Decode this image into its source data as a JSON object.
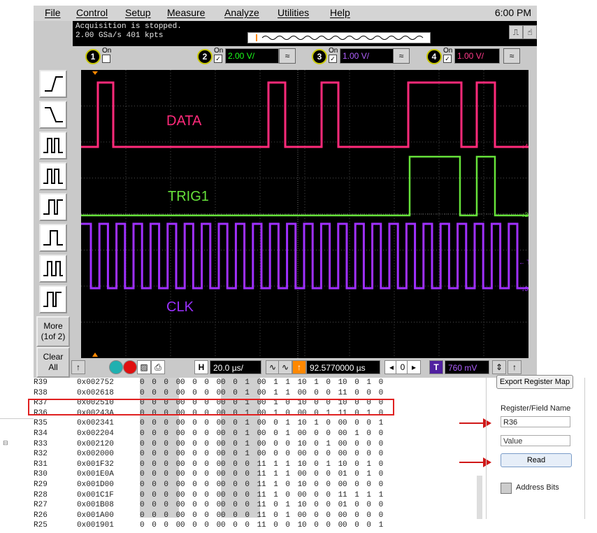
{
  "menubar": {
    "items": [
      "File",
      "Control",
      "Setup",
      "Measure",
      "Analyze",
      "Utilities",
      "Help"
    ],
    "clock": "6:00 PM"
  },
  "status": {
    "line1": "Acquisition is stopped.",
    "line2": "2.00 GSa/s   401 kpts"
  },
  "channels": [
    {
      "num": "1",
      "on_label": "On",
      "checked": false,
      "scale": ""
    },
    {
      "num": "2",
      "on_label": "On",
      "checked": true,
      "scale": "2.00 V/",
      "color": "#1aff1a"
    },
    {
      "num": "3",
      "on_label": "On",
      "checked": true,
      "scale": "1.00 V/",
      "color": "#a040ff"
    },
    {
      "num": "4",
      "on_label": "On",
      "checked": true,
      "scale": "1.00 V/",
      "color": "#ff2080"
    }
  ],
  "sidebar": {
    "more_label": "More\n(1of 2)",
    "clear_label": "Clear\nAll"
  },
  "waveforms": {
    "data_label": "DATA",
    "trig_label": "TRIG1",
    "clk_label": "CLK",
    "data_color": "#ff2a7a",
    "trig_color": "#66e23a",
    "clk_color": "#a030ff"
  },
  "bottombar": {
    "h_label": "H",
    "h_scale": "20.0 µs/",
    "delay": "92.5770000 µs",
    "t_label": "T",
    "trig_level": "760 mV"
  },
  "registers": {
    "rows": [
      {
        "name": "R39",
        "hex": "0x002752",
        "bits": [
          "0000",
          "0000",
          "0010",
          "0111",
          "0101",
          "0010"
        ]
      },
      {
        "name": "R38",
        "hex": "0x002618",
        "bits": [
          "0000",
          "0000",
          "0010",
          "0110",
          "0001",
          "1000"
        ]
      },
      {
        "name": "R37",
        "hex": "0x002510",
        "bits": [
          "0000",
          "0000",
          "0010",
          "0101",
          "0001",
          "0000"
        ]
      },
      {
        "name": "R36",
        "hex": "0x00243A",
        "bits": [
          "0000",
          "0000",
          "0010",
          "0100",
          "0011",
          "1010"
        ]
      },
      {
        "name": "R35",
        "hex": "0x002341",
        "bits": [
          "0000",
          "0000",
          "0010",
          "0011",
          "0100",
          "0001"
        ]
      },
      {
        "name": "R34",
        "hex": "0x002204",
        "bits": [
          "0000",
          "0000",
          "0010",
          "0010",
          "0000",
          "0100"
        ]
      },
      {
        "name": "R33",
        "hex": "0x002120",
        "bits": [
          "0000",
          "0000",
          "0010",
          "0001",
          "0010",
          "0000"
        ]
      },
      {
        "name": "R32",
        "hex": "0x002000",
        "bits": [
          "0000",
          "0000",
          "0010",
          "0000",
          "0000",
          "0000"
        ]
      },
      {
        "name": "R31",
        "hex": "0x001F32",
        "bits": [
          "0000",
          "0000",
          "0001",
          "1111",
          "0011",
          "0010"
        ]
      },
      {
        "name": "R30",
        "hex": "0x001E0A",
        "bits": [
          "0000",
          "0000",
          "0001",
          "1110",
          "0000",
          "1010"
        ]
      },
      {
        "name": "R29",
        "hex": "0x001D00",
        "bits": [
          "0000",
          "0000",
          "0001",
          "1101",
          "0000",
          "0000"
        ]
      },
      {
        "name": "R28",
        "hex": "0x001C1F",
        "bits": [
          "0000",
          "0000",
          "0001",
          "1100",
          "0001",
          "1111"
        ]
      },
      {
        "name": "R27",
        "hex": "0x001B08",
        "bits": [
          "0000",
          "0000",
          "0001",
          "1011",
          "0000",
          "1000"
        ]
      },
      {
        "name": "R26",
        "hex": "0x001A00",
        "bits": [
          "0000",
          "0000",
          "0001",
          "1010",
          "0000",
          "0000"
        ]
      },
      {
        "name": "R25",
        "hex": "0x001901",
        "bits": [
          "0000",
          "0000",
          "0001",
          "1001",
          "0000",
          "0001"
        ]
      }
    ]
  },
  "rightpanel": {
    "export_label": "Export Register Map",
    "field_label": "Register/Field Name",
    "field_value": "R36",
    "value_placeholder": "Value",
    "read_label": "Read",
    "address_bits_label": "Address Bits"
  }
}
